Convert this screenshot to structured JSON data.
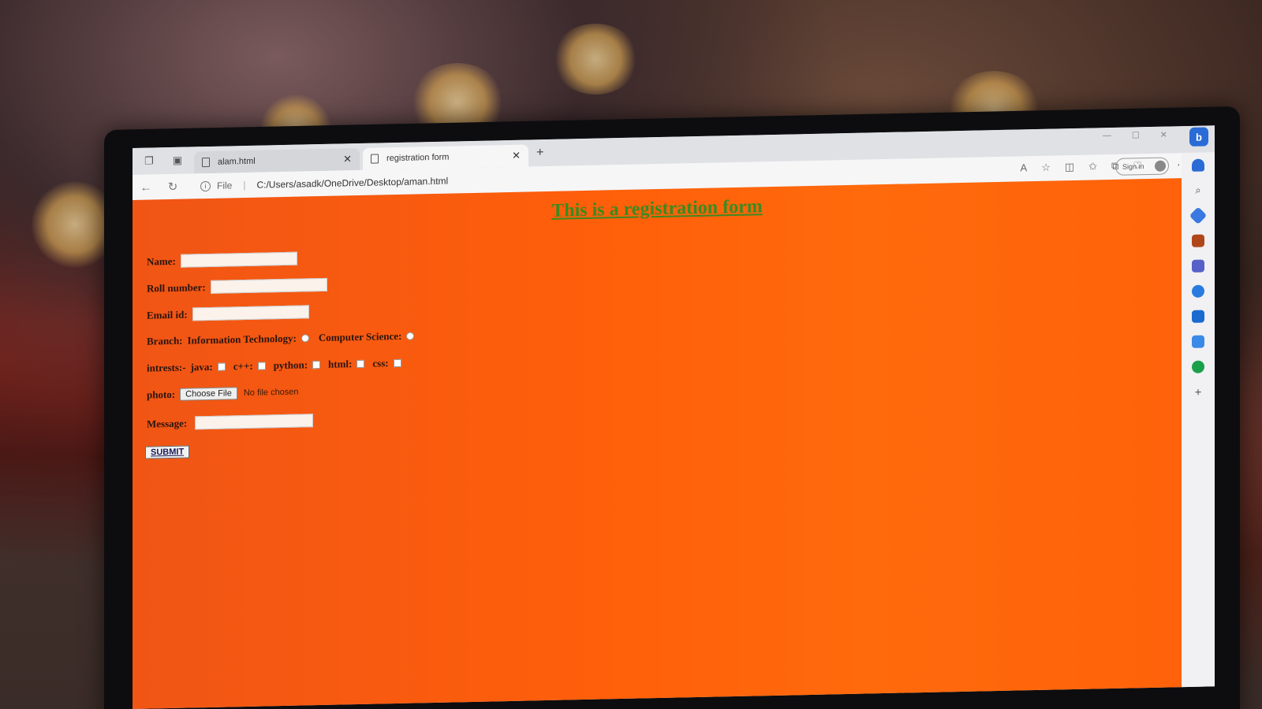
{
  "browser": {
    "tabs": [
      {
        "label": "alam.html",
        "active": false
      },
      {
        "label": "registration form",
        "active": true
      }
    ],
    "new_tab_glyph": "+",
    "address": {
      "scheme_label": "File",
      "url": "C:/Users/asadk/OneDrive/Desktop/aman.html"
    },
    "sign_in_label": "Sign in",
    "more_glyph": "···",
    "bing_glyph": "b"
  },
  "form": {
    "title": "This is a registration form",
    "name_label": "Name:",
    "roll_label": "Roll number:",
    "email_label": "Email id:",
    "branch_label": "Branch:",
    "branch_options": [
      "Information Technology:",
      "Computer Science:"
    ],
    "interests_label": "intrests:-",
    "interests_options": [
      "java:",
      "c++:",
      "python:",
      "html:",
      "css:"
    ],
    "photo_label": "photo:",
    "choose_file_label": "Choose File",
    "file_status": "No file chosen",
    "message_label": "Message:",
    "submit_label": "SUBMIT"
  },
  "colors": {
    "page_bg": "#ff5f0a",
    "title": "#3c8a1f",
    "label": "#2a1510"
  }
}
